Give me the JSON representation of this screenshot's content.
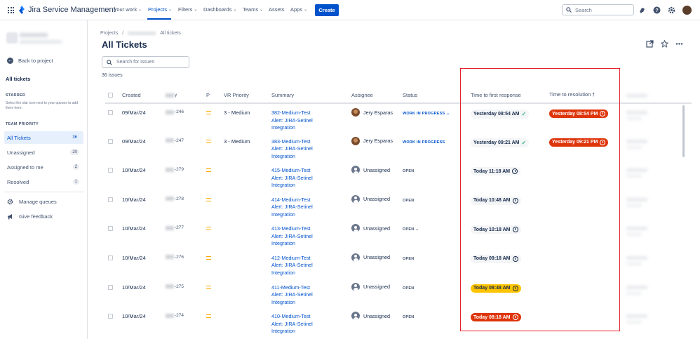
{
  "topbar": {
    "logo_text": "Jira Service Management",
    "nav": [
      {
        "label": "Your work",
        "active": false
      },
      {
        "label": "Projects",
        "active": true
      },
      {
        "label": "Filters",
        "active": false
      },
      {
        "label": "Dashboards",
        "active": false
      },
      {
        "label": "Teams",
        "active": false
      },
      {
        "label": "Assets",
        "active": false
      },
      {
        "label": "Apps",
        "active": false
      }
    ],
    "create_label": "Create",
    "search_placeholder": "Search"
  },
  "sidebar": {
    "back_label": "Back to project",
    "current_queue_heading": "All tickets",
    "starred_heading": "STARRED",
    "starred_note": "Select the star icon next to your queues to add them here.",
    "team_priority_heading": "TEAM PRIORITY",
    "queues": [
      {
        "label": "All Tickets",
        "count": "36",
        "selected": true
      },
      {
        "label": "Unassigned",
        "count": "20",
        "selected": false
      },
      {
        "label": "Assigned to me",
        "count": "2",
        "selected": false
      },
      {
        "label": "Resolved",
        "count": "1",
        "selected": false
      }
    ],
    "manage_queues_label": "Manage queues",
    "give_feedback_label": "Give feedback"
  },
  "main": {
    "breadcrumb": {
      "projects": "Projects",
      "separator": "/",
      "current": "All tickets"
    },
    "title": "All Tickets",
    "search_placeholder": "Search for issues",
    "issue_count": "36 issues",
    "columns": {
      "created": "Created",
      "key": "y",
      "p": "P",
      "vr_priority": "VR Priority",
      "summary": "Summary",
      "assignee": "Assignee",
      "status": "Status",
      "ttfr": "Time to first response",
      "ttr": "Time to resolution"
    },
    "rows": [
      {
        "created": "09/Mar/24",
        "key": "-246",
        "vr": "3 - Medium",
        "summary": [
          "382-Medium-Test",
          "Alert: JIRA-Setinel",
          "Integration"
        ],
        "assignee": "Jery Esparas",
        "assignee_type": "person",
        "status": "WORK IN PROGRESS",
        "status_type": "wip",
        "status_dropdown": true,
        "ttfr": "Yesterday 08:54 AM",
        "ttfr_style": "done",
        "ttr": "Yesterday 08:54 PM",
        "ttr_style": "red"
      },
      {
        "created": "09/Mar/24",
        "key": "-247",
        "vr": "3 - Medium",
        "summary": [
          "383-Medium-Test",
          "Alert: JIRA-Setinel",
          "Integration"
        ],
        "assignee": "Jery Esparas",
        "assignee_type": "person",
        "status": "WORK IN PROGRESS",
        "status_type": "wip",
        "status_dropdown": false,
        "ttfr": "Yesterday 09:21 AM",
        "ttfr_style": "done",
        "ttr": "Yesterday 09:21 PM",
        "ttr_style": "red"
      },
      {
        "created": "10/Mar/24",
        "key": "-279",
        "vr": "",
        "summary": [
          "415-Medium-Test",
          "Alert: JIRA-Setinel",
          "Integration"
        ],
        "assignee": "Unassigned",
        "assignee_type": "unassigned",
        "status": "OPEN",
        "status_type": "open",
        "status_dropdown": false,
        "ttfr": "Today 11:18 AM",
        "ttfr_style": "plain",
        "ttr": "",
        "ttr_style": "none"
      },
      {
        "created": "10/Mar/24",
        "key": "-278",
        "vr": "",
        "summary": [
          "414-Medium-Test",
          "Alert: JIRA-Setinel",
          "Integration"
        ],
        "assignee": "Unassigned",
        "assignee_type": "unassigned",
        "status": "OPEN",
        "status_type": "open",
        "status_dropdown": false,
        "ttfr": "Today 10:48 AM",
        "ttfr_style": "plain",
        "ttr": "",
        "ttr_style": "none"
      },
      {
        "created": "10/Mar/24",
        "key": "-277",
        "vr": "",
        "summary": [
          "413-Medium-Test",
          "Alert: JIRA-Setinel",
          "Integration"
        ],
        "assignee": "Unassigned",
        "assignee_type": "unassigned",
        "status": "OPEN",
        "status_type": "open",
        "status_dropdown": true,
        "ttfr": "Today 10:18 AM",
        "ttfr_style": "plain",
        "ttr": "",
        "ttr_style": "none"
      },
      {
        "created": "10/Mar/24",
        "key": "-276",
        "vr": "",
        "summary": [
          "412-Medium-Test",
          "Alert: JIRA-Setinel",
          "Integration"
        ],
        "assignee": "Unassigned",
        "assignee_type": "unassigned",
        "status": "OPEN",
        "status_type": "open",
        "status_dropdown": false,
        "ttfr": "Today 09:18 AM",
        "ttfr_style": "plain",
        "ttr": "",
        "ttr_style": "none"
      },
      {
        "created": "10/Mar/24",
        "key": "-275",
        "vr": "",
        "summary": [
          "411-Medium-Test",
          "Alert: JIRA-Setinel",
          "Integration"
        ],
        "assignee": "Unassigned",
        "assignee_type": "unassigned",
        "status": "OPEN",
        "status_type": "open",
        "status_dropdown": false,
        "ttfr": "Today 08:48 AM",
        "ttfr_style": "yellow",
        "ttr": "",
        "ttr_style": "none"
      },
      {
        "created": "10/Mar/24",
        "key": "-274",
        "vr": "",
        "summary": [
          "410-Medium-Test",
          "Alert: JIRA-Setinel",
          "Integration"
        ],
        "assignee": "Unassigned",
        "assignee_type": "unassigned",
        "status": "OPEN",
        "status_type": "open",
        "status_dropdown": false,
        "ttfr": "Today 08:18 AM",
        "ttfr_style": "red",
        "ttr": "",
        "ttr_style": "none"
      }
    ]
  },
  "colors": {
    "brand_blue": "#0052cc",
    "breach_red": "#de350b",
    "warning_yellow": "#ffc400",
    "met_green": "#36b37e",
    "highlight_box": "#e5202a"
  }
}
